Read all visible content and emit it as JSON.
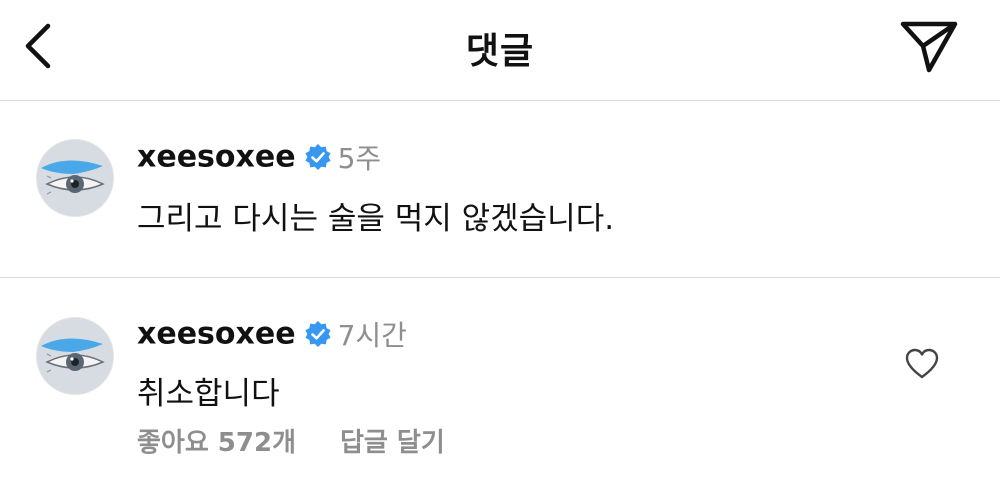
{
  "header": {
    "title": "댓글",
    "back_icon": "chevron-left-icon",
    "send_icon": "paper-plane-icon"
  },
  "comments": [
    {
      "username": "xeesoxee",
      "verified": true,
      "time": "5주",
      "text": "그리고 다시는 술을 먹지 않겠습니다."
    },
    {
      "username": "xeesoxee",
      "verified": true,
      "time": "7시간",
      "text": "취소합니다",
      "likes": "좋아요 572개",
      "reply": "답글 달기"
    }
  ],
  "colors": {
    "verified_badge": "#3897f0",
    "secondary_text": "#8e8e8e",
    "divider": "#dcdcdc"
  }
}
